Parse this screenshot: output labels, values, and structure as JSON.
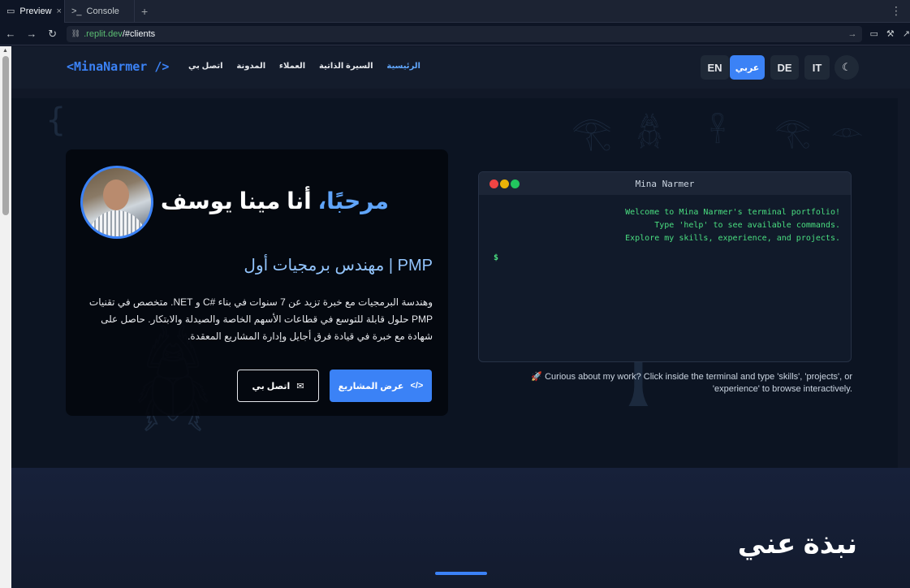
{
  "chrome": {
    "tabs": [
      {
        "label": "Preview"
      },
      {
        "label": "Console"
      }
    ],
    "url": {
      "domain": ".replit.dev",
      "path": "/#clients"
    }
  },
  "site": {
    "logo": "<MinaNarmer />",
    "nav": [
      "الرئيسية",
      "السيرة الذاتية",
      "العملاء",
      "المدونة",
      "اتصل بي"
    ],
    "languages": [
      "EN",
      "عربي",
      "DE",
      "IT"
    ],
    "active_language": "عربي",
    "hero": {
      "greeting_accent": "مرحبًا،",
      "greeting_rest": " أنا مينا يوسف",
      "role": "PMP | مهندس برمجيات أول",
      "bio": "وهندسة البرمجيات مع خبرة تزيد عن 7 سنوات في بناء #C و NET. متخصص في تقنيات PMP حلول قابلة للتوسع في قطاعات الأسهم الخاصة والصيدلة والابتكار. حاصل على شهادة مع خبرة في قيادة فرق أجايل وإدارة المشاريع المعقدة.",
      "primary_button": "عرض المشاريع",
      "secondary_button": "اتصل بي"
    },
    "terminal": {
      "title": "Mina Narmer",
      "lines": [
        "Welcome to Mina Narmer's terminal portfolio!",
        "Type 'help' to see available commands.",
        "Explore my skills, experience, and projects."
      ],
      "prompt": "$"
    },
    "hint": "🚀 Curious about my work? Click inside the terminal and type 'skills', 'projects', or 'experience' to browse interactively.",
    "about_title": "نبذة عني"
  },
  "colors": {
    "accent": "#3b82f6",
    "terminal_green": "#4ade80",
    "background": "#111827"
  }
}
